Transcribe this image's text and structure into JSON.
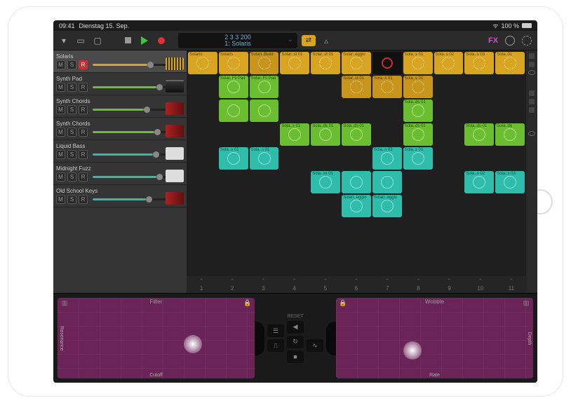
{
  "status": {
    "time": "09:41",
    "date": "Dienstag 15. Sep.",
    "battery": "100 %"
  },
  "lcd": {
    "top": "2  3  3  200",
    "bottom": "1: Solaris"
  },
  "toolbar": {
    "fx": "FX"
  },
  "cycle_label": "⇄",
  "tracks": [
    {
      "name": "Solaris",
      "vol": 62,
      "color": "#d9a420",
      "rec": true,
      "icon": "ti-yellow"
    },
    {
      "name": "Synth Pad",
      "vol": 72,
      "color": "#6abe30",
      "icon": "ti-synth"
    },
    {
      "name": "Synth Chords",
      "vol": 58,
      "color": "#6abe30",
      "icon": "ti-key"
    },
    {
      "name": "Synth Chords",
      "vol": 70,
      "color": "#6abe30",
      "icon": "ti-key"
    },
    {
      "name": "Liquid Bass",
      "vol": 68,
      "color": "#2fbdab",
      "icon": "ti-amp"
    },
    {
      "name": "Midnight Fuzz",
      "vol": 72,
      "color": "#2fbdab",
      "icon": "ti-amp"
    },
    {
      "name": "Old School Keys",
      "vol": 60,
      "color": "#2fbdab",
      "icon": "ti-key"
    }
  ],
  "msr": {
    "m": "M",
    "s": "S",
    "r": "R"
  },
  "grid_cols": 11,
  "column_numbers": [
    "1",
    "2",
    "3",
    "4",
    "5",
    "6",
    "7",
    "8",
    "9",
    "10",
    "11"
  ],
  "clips": [
    [
      {
        "c": "yel",
        "t": "Solaris"
      },
      {
        "c": "yel",
        "t": "Solaris"
      },
      {
        "c": "yel2",
        "t": "Solari..Build"
      },
      {
        "c": "yel",
        "t": "Solar..st 01"
      },
      {
        "c": "yel",
        "t": "Solar..st 01"
      },
      {
        "c": "yel",
        "t": "Solar..eggio"
      },
      {
        "c": "rec"
      },
      {
        "c": "yel",
        "t": "Sola..s 01"
      },
      {
        "c": "yel",
        "t": "Sola..s 02"
      },
      {
        "c": "yel",
        "t": "Sola..s 03"
      },
      {
        "c": "yel",
        "t": "Sola..01"
      }
    ],
    [
      null,
      {
        "c": "grn",
        "t": "Solar..Fil Pad"
      },
      {
        "c": "grn",
        "t": "Solar..Fil Pad"
      },
      null,
      null,
      {
        "c": "yel2",
        "t": "Solar..st 01"
      },
      {
        "c": "yel2",
        "t": "Sola..s 01"
      },
      {
        "c": "yel2",
        "t": "Sola..s 01"
      },
      null,
      null,
      null
    ],
    [
      null,
      {
        "c": "grn",
        "t": ""
      },
      {
        "c": "grn",
        "t": ""
      },
      null,
      null,
      null,
      null,
      {
        "c": "grn",
        "t": "Sola..ds 01"
      },
      null,
      null,
      null
    ],
    [
      null,
      null,
      null,
      {
        "c": "grn",
        "t": "Sola..s 01"
      },
      {
        "c": "grn",
        "t": "Sola..ds 01"
      },
      {
        "c": "grn",
        "t": "Sola..ds 01"
      },
      null,
      {
        "c": "grn",
        "t": "Sola..ds 01"
      },
      null,
      {
        "c": "grn",
        "t": "Sola..ds 01"
      },
      {
        "c": "grn",
        "t": "Sola..de"
      }
    ],
    [
      null,
      {
        "c": "cyn",
        "t": "Sola..s 01"
      },
      {
        "c": "cyn",
        "t": "Sola..s 01"
      },
      null,
      null,
      null,
      {
        "c": "cyn",
        "t": "Sola..s 03"
      },
      {
        "c": "cyn",
        "t": "Sola..s 01"
      },
      null,
      null,
      null
    ],
    [
      null,
      null,
      null,
      null,
      {
        "c": "cyn",
        "t": "Sola..ss 01"
      },
      {
        "c": "cyn",
        "t": ""
      },
      {
        "c": "cyn",
        "t": ""
      },
      null,
      null,
      {
        "c": "cyn",
        "t": "Sola..s 02"
      },
      {
        "c": "cyn",
        "t": "Sola..s 03"
      }
    ],
    [
      null,
      null,
      null,
      null,
      null,
      {
        "c": "cyn",
        "t": "Solari..eggio"
      },
      {
        "c": "cyn",
        "t": "Solari..eggio"
      },
      null,
      null,
      null,
      null
    ]
  ],
  "xy": {
    "left": {
      "title": "Filter",
      "x": "Cutoff",
      "y": "Resonance",
      "orb": [
        64,
        46
      ]
    },
    "right": {
      "title": "Wobble",
      "x": "Rate",
      "y": "Depth",
      "orb": [
        34,
        54
      ]
    },
    "reset": "RESET"
  }
}
